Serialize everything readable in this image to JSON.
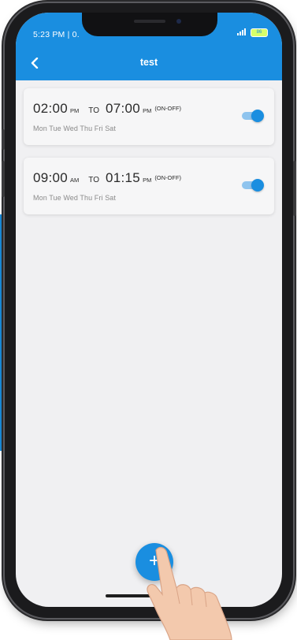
{
  "status_bar": {
    "time": "5:23 PM | 0.",
    "battery": "86"
  },
  "header": {
    "title": "test",
    "back_icon": "chevron-left-icon"
  },
  "schedules": [
    {
      "start_time": "02:00",
      "start_period": "PM",
      "separator": "TO",
      "end_time": "07:00",
      "end_period": "PM",
      "mode": "(ON-OFF)",
      "days": "Mon Tue Wed Thu Fri Sat",
      "enabled": true
    },
    {
      "start_time": "09:00",
      "start_period": "AM",
      "separator": "TO",
      "end_time": "01:15",
      "end_period": "PM",
      "mode": "(ON-OFF)",
      "days": "Mon Tue Wed Thu Fri Sat",
      "enabled": true
    }
  ],
  "fab": {
    "label": "+",
    "icon": "plus-icon"
  },
  "colors": {
    "primary": "#1a8ee0",
    "background": "#f0f0f2",
    "card": "#f6f6f7"
  }
}
